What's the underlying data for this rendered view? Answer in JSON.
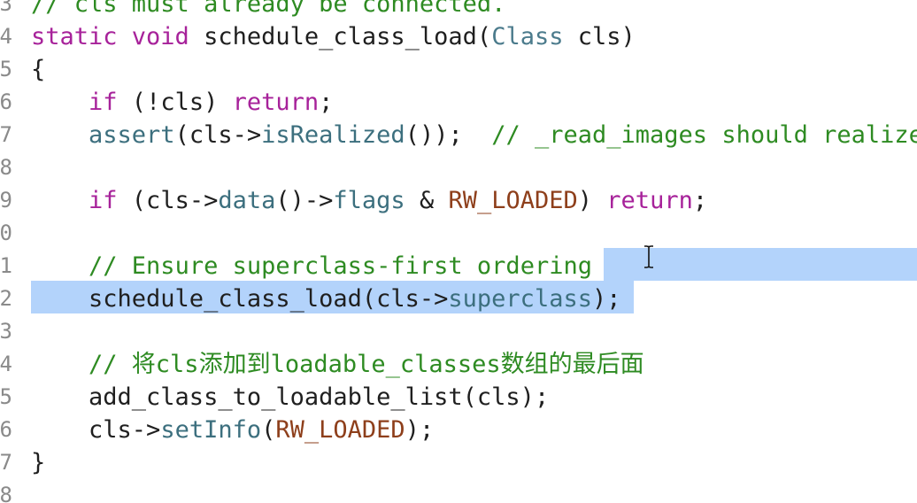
{
  "editor": {
    "lines": [
      {
        "number": "3",
        "segments": [
          {
            "text": "// cls must already be connected.",
            "cls": "c"
          }
        ]
      },
      {
        "number": "4",
        "segments": [
          {
            "text": "static void ",
            "cls": "k"
          },
          {
            "text": "schedule_class_load(",
            "cls": ""
          },
          {
            "text": "Class",
            "cls": "t"
          },
          {
            "text": " cls)",
            "cls": ""
          }
        ]
      },
      {
        "number": "5",
        "segments": [
          {
            "text": "{",
            "cls": ""
          }
        ]
      },
      {
        "number": "6",
        "segments": [
          {
            "text": "    ",
            "cls": ""
          },
          {
            "text": "if",
            "cls": "k"
          },
          {
            "text": " (!cls) ",
            "cls": ""
          },
          {
            "text": "return",
            "cls": "k"
          },
          {
            "text": ";",
            "cls": ""
          }
        ]
      },
      {
        "number": "7",
        "segments": [
          {
            "text": "    ",
            "cls": ""
          },
          {
            "text": "assert",
            "cls": "f"
          },
          {
            "text": "(cls->",
            "cls": ""
          },
          {
            "text": "isRealized",
            "cls": "f"
          },
          {
            "text": "());  ",
            "cls": ""
          },
          {
            "text": "// _read_images should realize",
            "cls": "c"
          }
        ]
      },
      {
        "number": "8",
        "segments": []
      },
      {
        "number": "9",
        "segments": [
          {
            "text": "    ",
            "cls": ""
          },
          {
            "text": "if",
            "cls": "k"
          },
          {
            "text": " (cls->",
            "cls": ""
          },
          {
            "text": "data",
            "cls": "f"
          },
          {
            "text": "()->",
            "cls": ""
          },
          {
            "text": "flags",
            "cls": "f"
          },
          {
            "text": " & ",
            "cls": ""
          },
          {
            "text": "RW_LOADED",
            "cls": "m"
          },
          {
            "text": ") ",
            "cls": ""
          },
          {
            "text": "return",
            "cls": "k"
          },
          {
            "text": ";",
            "cls": ""
          }
        ]
      },
      {
        "number": "0",
        "segments": []
      },
      {
        "number": "1",
        "segments": [
          {
            "text": "    ",
            "cls": ""
          },
          {
            "text": "// Ensure superclass-first ordering",
            "cls": "c"
          }
        ]
      },
      {
        "number": "2",
        "segments": [
          {
            "text": "    schedule_class_load(cls->",
            "cls": ""
          },
          {
            "text": "superclass",
            "cls": "f"
          },
          {
            "text": ");",
            "cls": ""
          }
        ]
      },
      {
        "number": "3",
        "segments": []
      },
      {
        "number": "4",
        "segments": [
          {
            "text": "    ",
            "cls": ""
          },
          {
            "text": "// 将cls添加到loadable_classes数组的最后面",
            "cls": "c"
          }
        ]
      },
      {
        "number": "5",
        "segments": [
          {
            "text": "    add_class_to_loadable_list(cls);",
            "cls": ""
          }
        ]
      },
      {
        "number": "6",
        "segments": [
          {
            "text": "    cls->",
            "cls": ""
          },
          {
            "text": "setInfo",
            "cls": "f"
          },
          {
            "text": "(",
            "cls": ""
          },
          {
            "text": "RW_LOADED",
            "cls": "m"
          },
          {
            "text": ");",
            "cls": ""
          }
        ]
      },
      {
        "number": "7",
        "segments": [
          {
            "text": "}",
            "cls": ""
          }
        ]
      },
      {
        "number": "8",
        "segments": []
      }
    ],
    "selection_color": "#b3d3fb"
  }
}
